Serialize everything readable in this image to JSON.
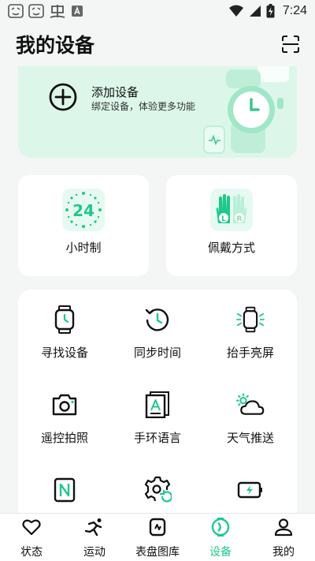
{
  "status_bar": {
    "time": "7:24"
  },
  "header": {
    "title": "我的设备",
    "scan_icon": "scan-icon"
  },
  "add_device": {
    "title": "添加设备",
    "subtitle": "绑定设备，体验更多功能",
    "icon": "plus-circle-icon"
  },
  "quick_cards": [
    {
      "label": "小时制",
      "icon": "clock-24-icon",
      "icon_text": "24"
    },
    {
      "label": "佩戴方式",
      "icon": "wear-hands-icon",
      "left_hand": "L",
      "right_hand": "R"
    }
  ],
  "features": [
    {
      "label": "寻找设备",
      "icon": "watch-icon"
    },
    {
      "label": "同步时间",
      "icon": "sync-time-icon"
    },
    {
      "label": "抬手亮屏",
      "icon": "raise-screen-icon"
    },
    {
      "label": "遥控拍照",
      "icon": "camera-icon"
    },
    {
      "label": "手环语言",
      "icon": "language-icon"
    },
    {
      "label": "天气推送",
      "icon": "weather-icon"
    },
    {
      "label": "",
      "icon": "nfc-icon"
    },
    {
      "label": "",
      "icon": "settings-refresh-icon"
    },
    {
      "label": "",
      "icon": "battery-icon"
    }
  ],
  "bottom_nav": [
    {
      "label": "状态",
      "icon": "heart-icon",
      "active": false
    },
    {
      "label": "运动",
      "icon": "run-icon",
      "active": false
    },
    {
      "label": "表盘图库",
      "icon": "watchface-icon",
      "active": false
    },
    {
      "label": "设备",
      "icon": "device-icon",
      "active": true
    },
    {
      "label": "我的",
      "icon": "profile-icon",
      "active": false
    }
  ],
  "colors": {
    "accent": "#1ec98a",
    "banner_bg": "#dcf7ea",
    "page_bg": "#f4f5f5"
  }
}
